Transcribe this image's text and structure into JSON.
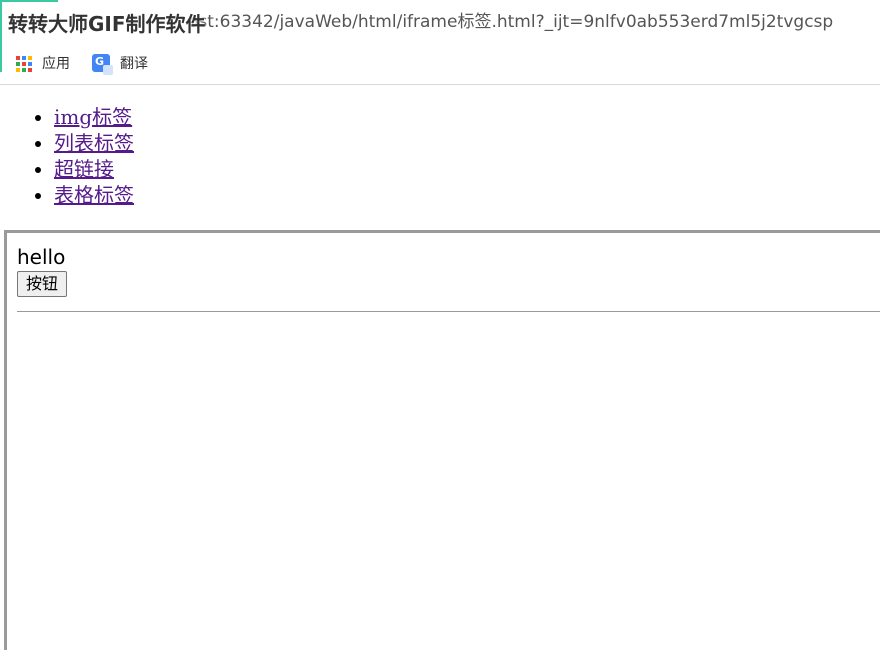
{
  "browser": {
    "watermark": "转转大师GIF制作软件",
    "address_fragment": "ost:63342/javaWeb/html/iframe标签.html?_ijt=9nlfv0ab553erd7ml5j2tvgcsp",
    "bookmarks": [
      {
        "label": "应用",
        "icon": "apps-grid-icon"
      },
      {
        "label": "翻译",
        "icon": "translate-icon"
      }
    ],
    "accent_color": "#3cc8a0"
  },
  "page": {
    "links": [
      {
        "label": "img标签"
      },
      {
        "label": "列表标签"
      },
      {
        "label": "超链接"
      },
      {
        "label": "表格标签"
      }
    ],
    "link_color": "#551a8b",
    "iframe": {
      "text": "hello",
      "button_label": "按钮"
    }
  }
}
